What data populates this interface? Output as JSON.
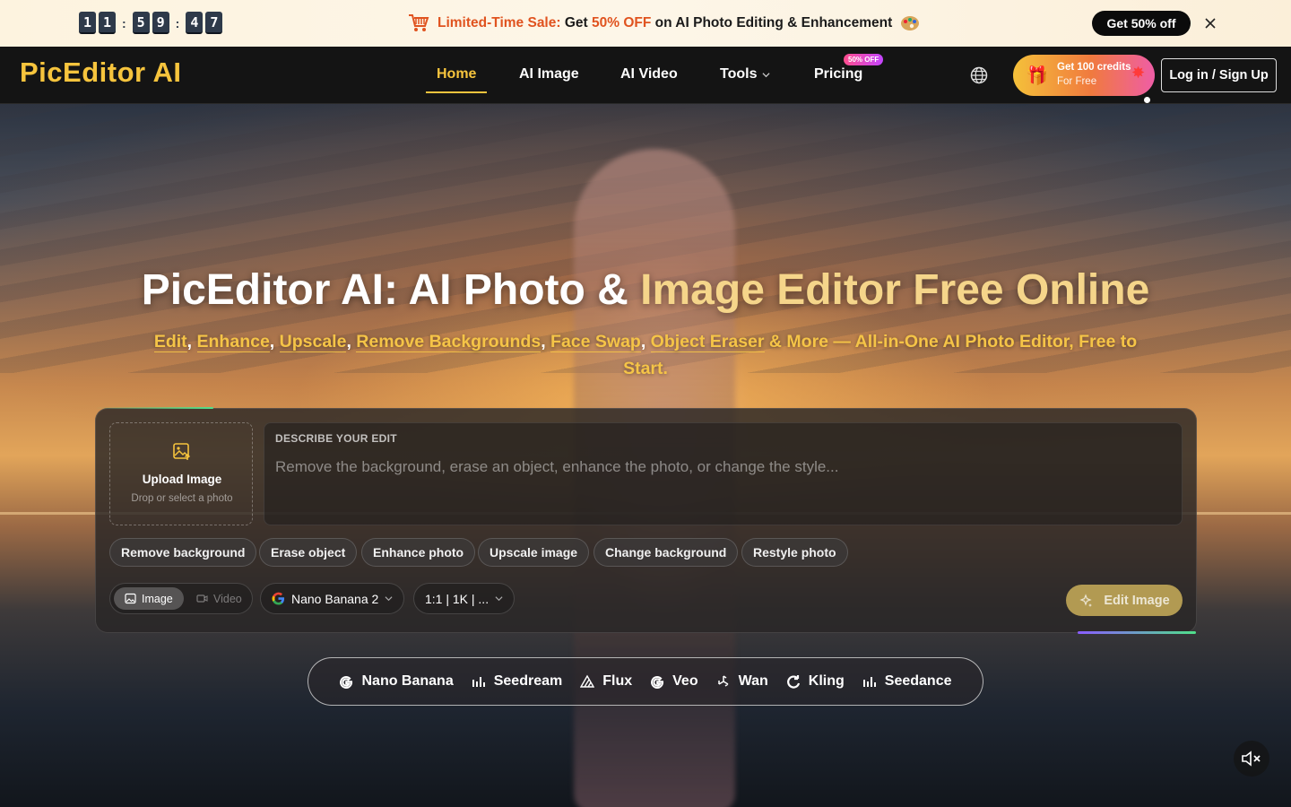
{
  "promo": {
    "countdown": [
      "1",
      "1",
      "5",
      "9",
      "4",
      "7"
    ],
    "colon": ":",
    "sale_prefix": "Limited-Time Sale:",
    "sale_text_1": "Get",
    "sale_highlight": "50% OFF",
    "sale_text_2": "on AI Photo Editing & Enhancement",
    "cta": "Get 50% off"
  },
  "nav": {
    "logo": "PicEditor AI",
    "items": [
      {
        "label": "Home",
        "active": true
      },
      {
        "label": "AI Image"
      },
      {
        "label": "AI Video"
      },
      {
        "label": "Tools"
      },
      {
        "label": "Pricing"
      }
    ],
    "pricing_badge": "50% OFF",
    "credits_title": "Get 100 credits",
    "credits_sub": "For Free",
    "login": "Log in / Sign Up"
  },
  "hero": {
    "title_white": "PicEditor AI: AI Photo & ",
    "title_gold": "Image Editor Free Online",
    "links": [
      "Edit",
      "Enhance",
      "Upscale",
      "Remove Backgrounds",
      "Face Swap",
      "Object Eraser"
    ],
    "separator": ",",
    "subtitle_tail": "& More — All-in-One AI Photo Editor, Free to Start."
  },
  "editor": {
    "upload_title": "Upload Image",
    "upload_sub": "Drop or select a photo",
    "prompt_label": "DESCRIBE YOUR EDIT",
    "prompt_placeholder": "Remove the background, erase an object, enhance the photo, or change the style...",
    "chips": [
      "Remove background",
      "Erase object",
      "Enhance photo",
      "Upscale image",
      "Change background",
      "Restyle photo"
    ],
    "mode_image": "Image",
    "mode_video": "Video",
    "model": "Nano Banana 2",
    "ratio": "1:1 | 1K | ...",
    "submit": "Edit Image"
  },
  "models": [
    "Nano Banana",
    "Seedream",
    "Flux",
    "Veo",
    "Wan",
    "Kling",
    "Seedance"
  ],
  "colors": {
    "accent": "#f6c43d",
    "sale": "#e0531f",
    "submit": "#b29a52"
  }
}
